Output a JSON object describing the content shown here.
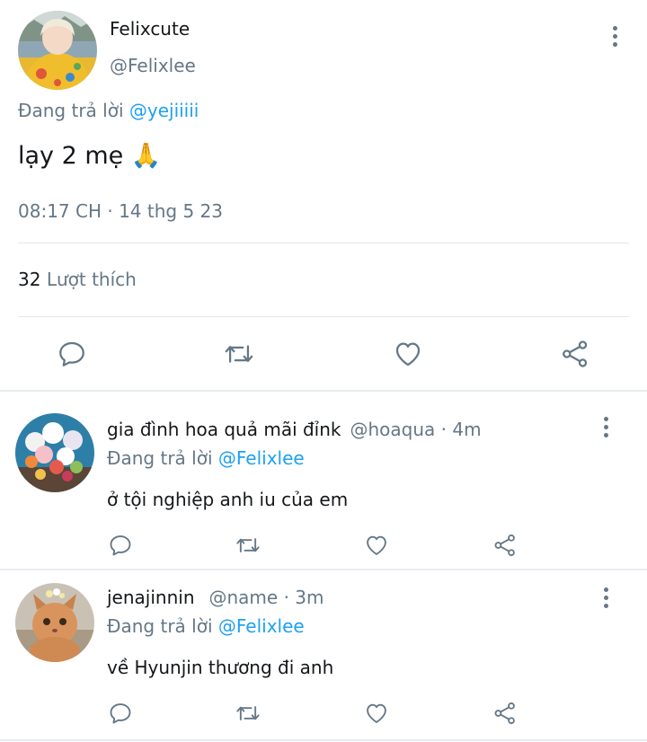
{
  "main_tweet": {
    "display_name": "Felixcute",
    "handle": "@Felixlee",
    "reply_prefix": "Đang trả lời",
    "reply_mention": "@yejiiiii",
    "text": "lạy 2 mẹ 🙏",
    "timestamp": "08:17 CH · 14 thg 5 23",
    "likes_count": "32",
    "likes_label": "Lượt thích",
    "actions": [
      "reply-icon",
      "retweet-icon",
      "like-icon",
      "share-icon"
    ]
  },
  "replies": [
    {
      "display_name": "gia đình hoa quả mãi đỉnk",
      "handle": "@hoaqua",
      "time": "4m",
      "reply_prefix": "Đang trả lời",
      "reply_mention": "@Felixlee",
      "text": "ở tội nghiệp anh iu của em"
    },
    {
      "display_name": "jenajinnin",
      "handle": "@name",
      "time": "3m",
      "reply_prefix": "Đang trả lời",
      "reply_mention": "@Felixlee",
      "text": "về Hyunjin thương đi anh"
    }
  ],
  "colors": {
    "text": "#14171a",
    "secondary": "#657786",
    "accent": "#1da1f2",
    "divider": "#e1e8ed"
  }
}
